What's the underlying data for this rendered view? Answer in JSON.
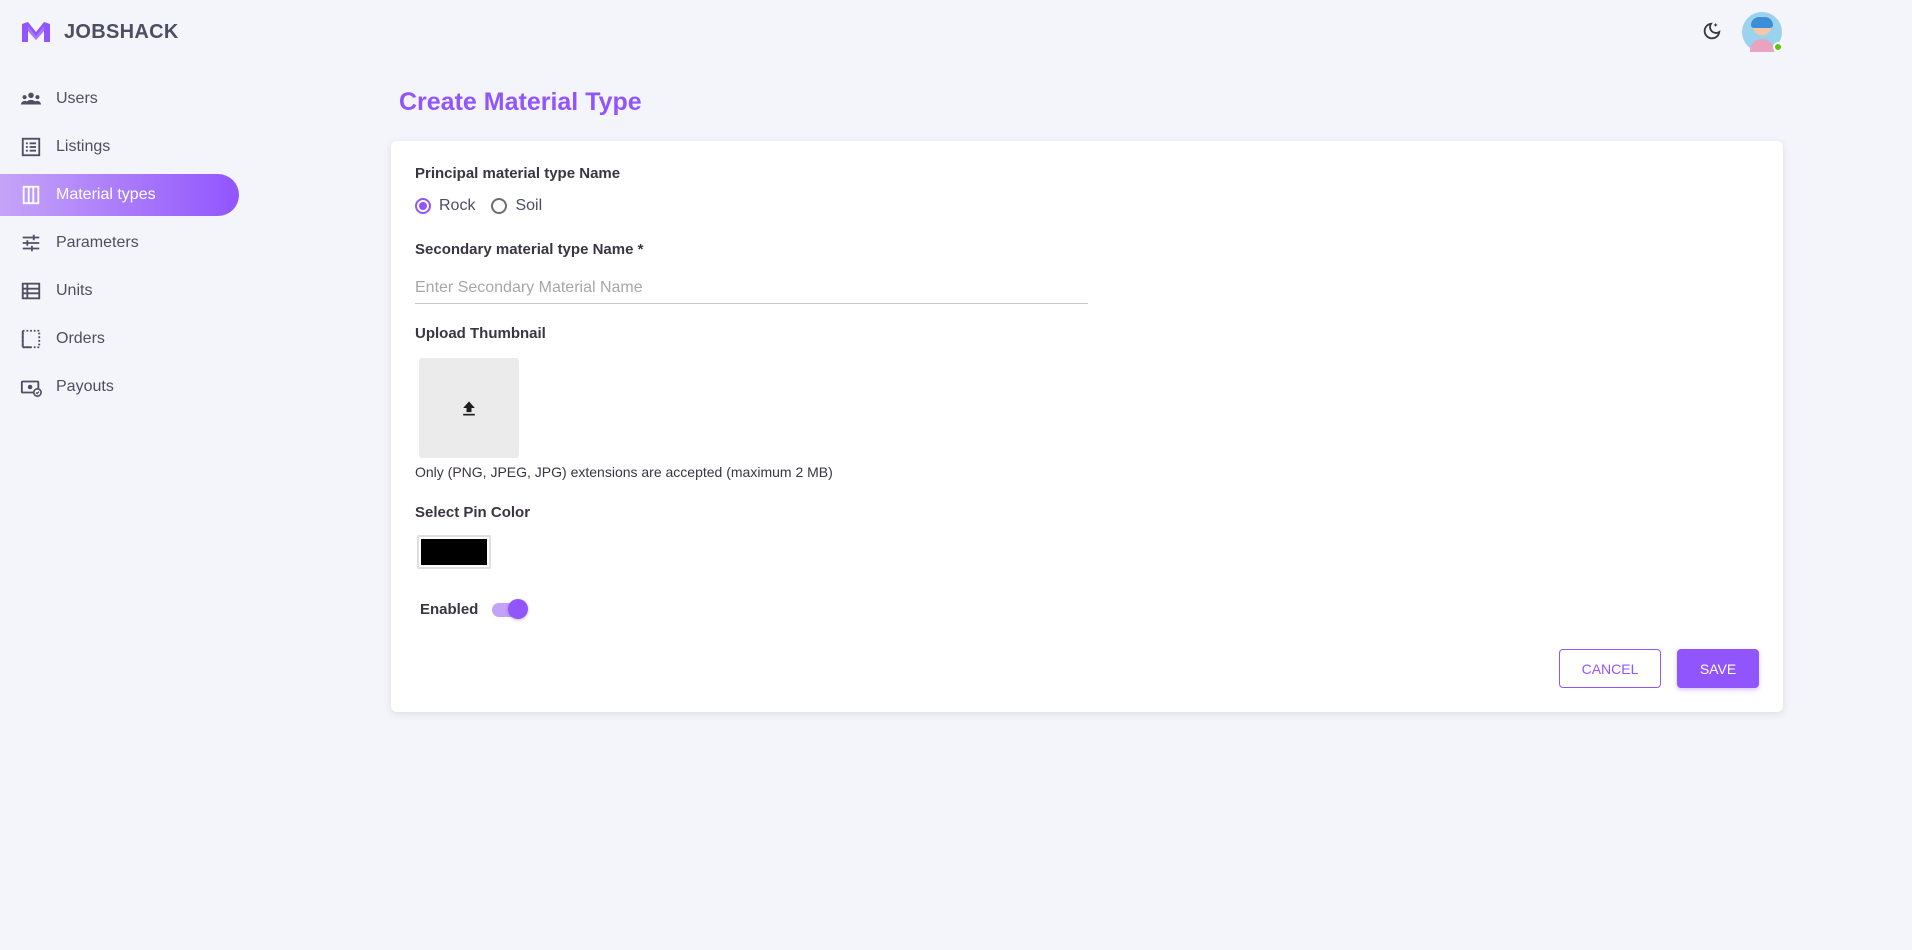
{
  "app": {
    "name": "JOBSHACK"
  },
  "sidebar": {
    "items": [
      {
        "label": "Users",
        "icon": "users-icon"
      },
      {
        "label": "Listings",
        "icon": "list-icon"
      },
      {
        "label": "Material types",
        "icon": "columns-icon",
        "active": true
      },
      {
        "label": "Parameters",
        "icon": "sliders-icon"
      },
      {
        "label": "Units",
        "icon": "table-list-icon"
      },
      {
        "label": "Orders",
        "icon": "dotted-square-icon"
      },
      {
        "label": "Payouts",
        "icon": "payout-icon"
      }
    ]
  },
  "header": {
    "theme_icon": "moon-icon",
    "avatar_status": "online"
  },
  "page": {
    "title": "Create Material Type"
  },
  "form": {
    "principal_label": "Principal material type Name",
    "principal_options": [
      "Rock",
      "Soil"
    ],
    "principal_selected": "Rock",
    "secondary_label": "Secondary material type Name *",
    "secondary_placeholder": "Enter Secondary Material Name",
    "secondary_value": "",
    "upload_label": "Upload Thumbnail",
    "upload_hint": "Only (PNG, JPEG, JPG) extensions are accepted (maximum 2 MB)",
    "pin_color_label": "Select Pin Color",
    "pin_color": "#000000",
    "enabled_label": "Enabled",
    "enabled": true,
    "cancel_label": "CANCEL",
    "save_label": "SAVE"
  },
  "colors": {
    "accent": "#9155fd",
    "background": "#f4f5fa",
    "text": "#3a3541"
  }
}
